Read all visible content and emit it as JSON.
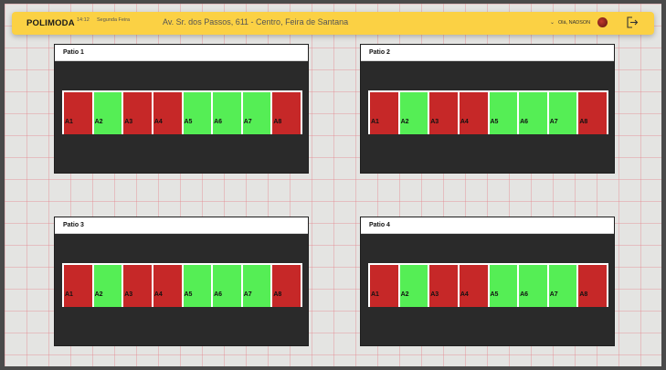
{
  "header": {
    "brand": "POLIMODA",
    "time": "14:12",
    "weekday": "Segunda Feira",
    "address": "Av. Sr. dos Passos, 611 - Centro, Feira de Santana",
    "greeting": "Olá, NADSON",
    "icons": [
      "chevron-down-icon",
      "avatar",
      "logout-icon"
    ]
  },
  "colors": {
    "accent": "#fbd144",
    "occupied": "#c62828",
    "free": "#55ee55",
    "panel_bg": "#2a2a2a"
  },
  "patios": [
    {
      "title": "Patio 1",
      "slots": [
        {
          "label": "A1",
          "status": "occupied"
        },
        {
          "label": "A2",
          "status": "free"
        },
        {
          "label": "A3",
          "status": "occupied"
        },
        {
          "label": "A4",
          "status": "occupied"
        },
        {
          "label": "A5",
          "status": "free"
        },
        {
          "label": "A6",
          "status": "free"
        },
        {
          "label": "A7",
          "status": "free"
        },
        {
          "label": "A8",
          "status": "occupied"
        }
      ]
    },
    {
      "title": "Patio 2",
      "slots": [
        {
          "label": "A1",
          "status": "occupied"
        },
        {
          "label": "A2",
          "status": "free"
        },
        {
          "label": "A3",
          "status": "occupied"
        },
        {
          "label": "A4",
          "status": "occupied"
        },
        {
          "label": "A5",
          "status": "free"
        },
        {
          "label": "A6",
          "status": "free"
        },
        {
          "label": "A7",
          "status": "free"
        },
        {
          "label": "A8",
          "status": "occupied"
        }
      ]
    },
    {
      "title": "Patio 3",
      "slots": [
        {
          "label": "A1",
          "status": "occupied"
        },
        {
          "label": "A2",
          "status": "free"
        },
        {
          "label": "A3",
          "status": "occupied"
        },
        {
          "label": "A4",
          "status": "occupied"
        },
        {
          "label": "A5",
          "status": "free"
        },
        {
          "label": "A6",
          "status": "free"
        },
        {
          "label": "A7",
          "status": "free"
        },
        {
          "label": "A8",
          "status": "occupied"
        }
      ]
    },
    {
      "title": "Patio 4",
      "slots": [
        {
          "label": "A1",
          "status": "occupied"
        },
        {
          "label": "A2",
          "status": "free"
        },
        {
          "label": "A3",
          "status": "occupied"
        },
        {
          "label": "A4",
          "status": "occupied"
        },
        {
          "label": "A5",
          "status": "free"
        },
        {
          "label": "A6",
          "status": "free"
        },
        {
          "label": "A7",
          "status": "free"
        },
        {
          "label": "A8",
          "status": "occupied"
        }
      ]
    }
  ]
}
